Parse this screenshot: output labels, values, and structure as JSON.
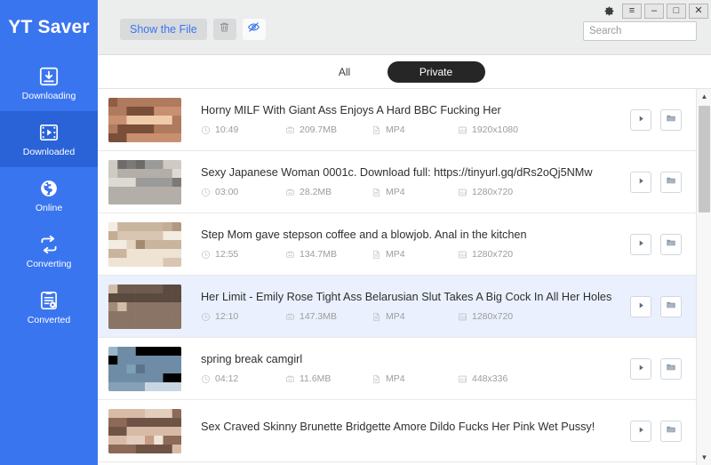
{
  "app": {
    "brand": "YT Saver",
    "accent_color": "#3a75f0",
    "accent_active_color": "#2a63d8",
    "tab_active_bg": "#262626",
    "row_selected_bg": "#eaf0fd"
  },
  "sidebar": {
    "items": [
      {
        "label": "Downloading",
        "icon": "download-box-icon",
        "active": false
      },
      {
        "label": "Downloaded",
        "icon": "film-strip-icon",
        "active": true
      },
      {
        "label": "Online",
        "icon": "globe-icon",
        "active": false
      },
      {
        "label": "Converting",
        "icon": "convert-loop-icon",
        "active": false
      },
      {
        "label": "Converted",
        "icon": "clipboard-sync-icon",
        "active": false
      }
    ]
  },
  "titlebar": {
    "gear_icon": "gear-icon",
    "menu_label": "≡",
    "minimize_label": "–",
    "maximize_label": "□",
    "close_label": "✕"
  },
  "toolbar": {
    "show_file_label": "Show the File",
    "delete_icon": "trash-icon",
    "hide_icon": "eye-off-icon"
  },
  "search": {
    "placeholder": "Search",
    "value": ""
  },
  "tabs": [
    {
      "label": "All",
      "active": false
    },
    {
      "label": "Private",
      "active": true
    }
  ],
  "list": {
    "rows": [
      {
        "title": "Horny MILF With Giant Ass Enjoys A Hard BBC Fucking Her",
        "duration": "10:49",
        "size": "209.7MB",
        "format": "MP4",
        "resolution": "1920x1080",
        "selected": false
      },
      {
        "title": "Sexy Japanese Woman 0001c. Download full: https://tinyurl.gq/dRs2oQj5NMw",
        "duration": "03:00",
        "size": "28.2MB",
        "format": "MP4",
        "resolution": "1280x720",
        "selected": false
      },
      {
        "title": "Step Mom gave stepson coffee and a blowjob. Anal in the kitchen",
        "duration": "12:55",
        "size": "134.7MB",
        "format": "MP4",
        "resolution": "1280x720",
        "selected": false
      },
      {
        "title": "Her Limit - Emily Rose Tight Ass Belarusian Slut Takes A Big Cock In All Her Holes",
        "duration": "12:10",
        "size": "147.3MB",
        "format": "MP4",
        "resolution": "1280x720",
        "selected": true
      },
      {
        "title": "spring break camgirl",
        "duration": "04:12",
        "size": "11.6MB",
        "format": "MP4",
        "resolution": "448x336",
        "selected": false
      },
      {
        "title": "Sex Craved Skinny Brunette Bridgette Amore Dildo Fucks Her Pink Wet Pussy!",
        "duration": "",
        "size": "",
        "format": "",
        "resolution": "",
        "selected": false
      }
    ],
    "row_actions": [
      {
        "icon": "play-icon",
        "name": "play-button"
      },
      {
        "icon": "folder-icon",
        "name": "open-folder-button"
      }
    ],
    "meta_icons": {
      "duration": "clock-icon",
      "size": "hard-drive-icon",
      "format": "file-icon",
      "resolution": "resolution-icon"
    }
  },
  "scrollbar": {
    "up_label": "▲",
    "down_label": "▼"
  }
}
